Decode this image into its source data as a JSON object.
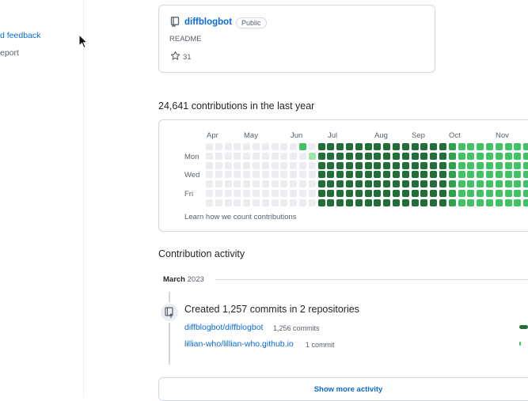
{
  "sidebar": {
    "feedback_link": "d feedback",
    "report_text": "eport"
  },
  "repo_card": {
    "name": "diffblogbot",
    "visibility": "Public",
    "description": "README",
    "stars": "31",
    "icons": {
      "repo": "repo-icon",
      "star": "star-icon"
    }
  },
  "contributions": {
    "heading": "24,641 contributions in the last year",
    "months": [
      "Apr",
      "May",
      "Jun",
      "Jul",
      "Aug",
      "Sep",
      "Oct",
      "Nov"
    ],
    "days": [
      "Mon",
      "Wed",
      "Fri"
    ],
    "learn_link": "Learn how we count contributions",
    "level_colors": [
      "#ebedf0",
      "#9be9a8",
      "#40c463",
      "#30a14e",
      "#216e39"
    ],
    "weeks": [
      [
        0,
        0,
        0,
        0,
        0,
        0,
        0
      ],
      [
        0,
        0,
        0,
        0,
        0,
        0,
        0
      ],
      [
        0,
        0,
        0,
        0,
        0,
        0,
        0
      ],
      [
        0,
        0,
        0,
        0,
        0,
        0,
        0
      ],
      [
        0,
        0,
        0,
        0,
        0,
        0,
        0
      ],
      [
        0,
        0,
        0,
        0,
        0,
        0,
        0
      ],
      [
        0,
        0,
        0,
        0,
        0,
        0,
        0
      ],
      [
        0,
        0,
        0,
        0,
        0,
        0,
        0
      ],
      [
        0,
        0,
        0,
        0,
        0,
        0,
        0
      ],
      [
        0,
        0,
        0,
        0,
        0,
        0,
        0
      ],
      [
        2,
        0,
        0,
        0,
        0,
        0,
        0
      ],
      [
        0,
        1,
        0,
        0,
        0,
        0,
        0
      ],
      [
        4,
        4,
        4,
        4,
        4,
        4,
        4
      ],
      [
        4,
        4,
        4,
        4,
        4,
        4,
        4
      ],
      [
        4,
        4,
        4,
        4,
        4,
        4,
        4
      ],
      [
        4,
        4,
        4,
        4,
        4,
        4,
        4
      ],
      [
        4,
        4,
        4,
        4,
        4,
        4,
        4
      ],
      [
        4,
        4,
        4,
        4,
        4,
        4,
        4
      ],
      [
        4,
        4,
        4,
        4,
        4,
        4,
        4
      ],
      [
        4,
        4,
        4,
        4,
        4,
        4,
        4
      ],
      [
        4,
        4,
        4,
        4,
        4,
        4,
        4
      ],
      [
        4,
        4,
        4,
        4,
        4,
        4,
        4
      ],
      [
        4,
        4,
        4,
        4,
        4,
        4,
        4
      ],
      [
        4,
        4,
        4,
        4,
        4,
        4,
        4
      ],
      [
        4,
        4,
        4,
        4,
        4,
        4,
        4
      ],
      [
        4,
        4,
        4,
        4,
        4,
        4,
        4
      ],
      [
        3,
        3,
        3,
        3,
        3,
        3,
        3
      ],
      [
        2,
        2,
        2,
        2,
        2,
        2,
        2
      ],
      [
        2,
        2,
        2,
        2,
        2,
        2,
        2
      ],
      [
        2,
        2,
        2,
        2,
        2,
        2,
        2
      ],
      [
        2,
        2,
        2,
        2,
        2,
        2,
        2
      ],
      [
        2,
        2,
        2,
        2,
        2,
        2,
        2
      ],
      [
        2,
        2,
        2,
        2,
        2,
        2,
        2
      ],
      [
        2,
        2,
        2,
        2,
        2,
        2,
        2
      ],
      [
        2,
        2,
        2,
        2,
        2,
        2,
        2
      ]
    ]
  },
  "activity": {
    "heading": "Contribution activity",
    "period_month": "March",
    "period_year": "2023",
    "commit_title": "Created 1,257 commits in 2 repositories",
    "icon": "repo-push-icon",
    "repos": [
      {
        "name": "diffblogbot/diffblogbot",
        "count": "1,256 commits",
        "share": 0.999
      },
      {
        "name": "lillian-who/lillian-who.github.io",
        "count": "1 commit",
        "share": 0.001
      }
    ],
    "show_more": "Show more activity"
  }
}
